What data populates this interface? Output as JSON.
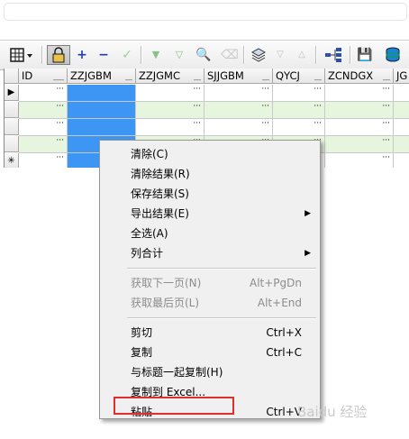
{
  "toolbar": {
    "icons": [
      "grid-menu-icon",
      "lock-icon",
      "add-record-icon",
      "remove-record-icon",
      "confirm-icon",
      "filter-down-icon",
      "filter-icon",
      "binoculars-icon",
      "eraser-icon",
      "layer-icon",
      "sort-desc-icon",
      "sort-asc-icon",
      "tree-icon",
      "save-icon",
      "database-icon"
    ],
    "add_glyph": "+",
    "remove_glyph": "−",
    "check_glyph": "✓",
    "find_glyph": "🔍",
    "save_glyph": "💾"
  },
  "grid": {
    "columns": [
      "ID",
      "ZZJGBM",
      "ZZJGMC",
      "SJJGBM",
      "QYCJ",
      "ZCNDGX",
      "JG"
    ],
    "ellipsis": "···",
    "rows": [
      {
        "indicator": "▶"
      },
      {
        "indicator": ""
      },
      {
        "indicator": ""
      },
      {
        "indicator": ""
      },
      {
        "indicator": "✳"
      }
    ],
    "row_colors": [
      "#ffffff",
      "#e6f5de",
      "#ffffff",
      "#e6f5de",
      "#ffffff"
    ],
    "selection_color": "#3d96f4"
  },
  "context_menu": {
    "items": [
      {
        "label": "清除(C)",
        "shortcut": "",
        "submenu": false,
        "disabled": false
      },
      {
        "label": "清除结果(R)",
        "shortcut": "",
        "submenu": false,
        "disabled": false
      },
      {
        "label": "保存结果(S)",
        "shortcut": "",
        "submenu": false,
        "disabled": false
      },
      {
        "label": "导出结果(E)",
        "shortcut": "",
        "submenu": true,
        "disabled": false
      },
      {
        "label": "全选(A)",
        "shortcut": "",
        "submenu": false,
        "disabled": false
      },
      {
        "label": "列合计",
        "shortcut": "",
        "submenu": true,
        "disabled": false
      },
      {
        "label": "获取下一页(N)",
        "shortcut": "Alt+PgDn",
        "submenu": false,
        "disabled": true
      },
      {
        "label": "获取最后页(L)",
        "shortcut": "Alt+End",
        "submenu": false,
        "disabled": true
      },
      {
        "label": "剪切",
        "shortcut": "Ctrl+X",
        "submenu": false,
        "disabled": false
      },
      {
        "label": "复制",
        "shortcut": "Ctrl+C",
        "submenu": false,
        "disabled": false
      },
      {
        "label": "与标题一起复制(H)",
        "shortcut": "",
        "submenu": false,
        "disabled": false
      },
      {
        "label": "复制到 Excel...",
        "shortcut": "",
        "submenu": false,
        "disabled": false
      },
      {
        "label": "粘贴",
        "shortcut": "Ctrl+V",
        "submenu": false,
        "disabled": false
      }
    ],
    "submenu_arrow": "▶",
    "highlight_color": "#e0302c"
  },
  "watermark": {
    "text": "Baidu 经验"
  }
}
